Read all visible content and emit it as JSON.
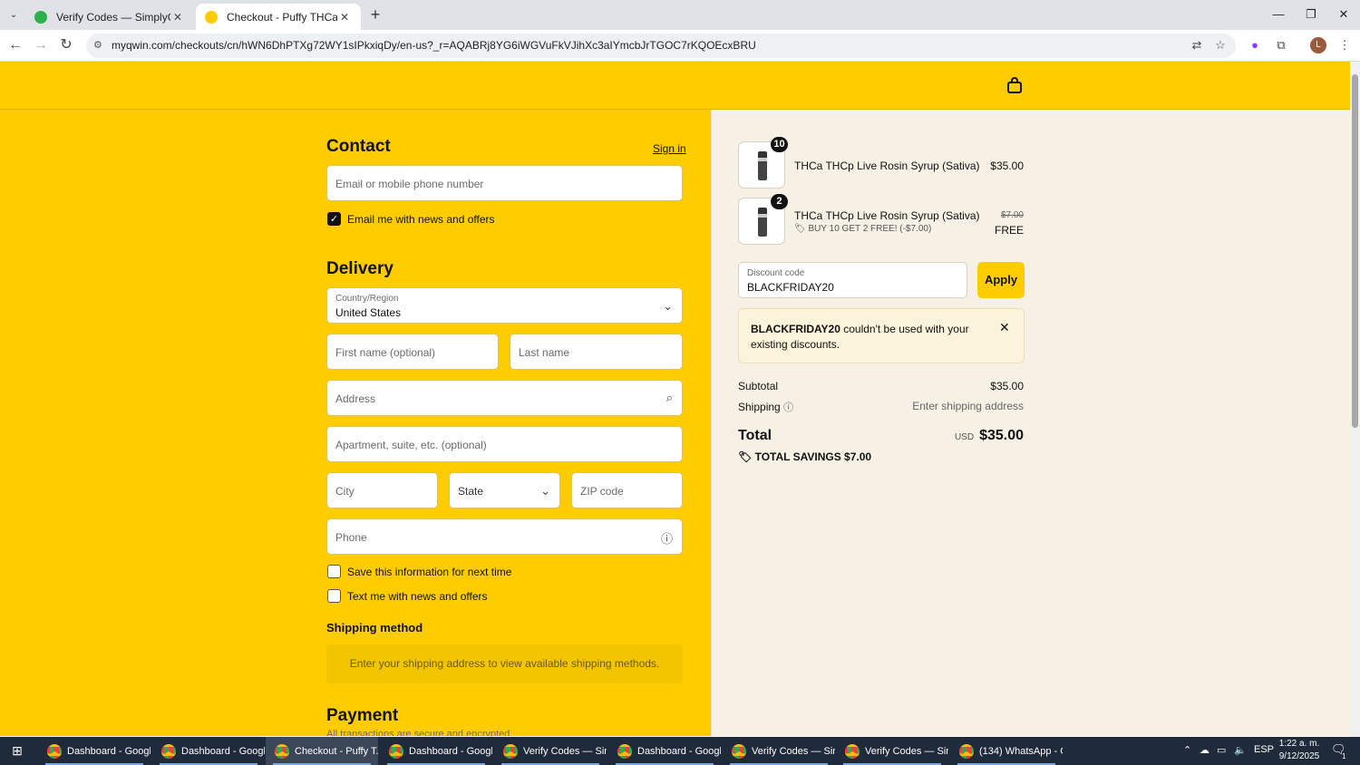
{
  "browser": {
    "tabs": [
      {
        "title": "Verify Codes — SimplyCodes",
        "active": false
      },
      {
        "title": "Checkout - Puffy THCa",
        "active": true
      }
    ],
    "url": "myqwin.com/checkouts/cn/hWN6DhPTXg72WY1sIPkxiqDy/en-us?_r=AQABRj8YG6iWGVuFkVJihXc3aIYmcbJrTGOC7rKQOEcxBRU"
  },
  "contact": {
    "heading": "Contact",
    "sign_in": "Sign in",
    "email_placeholder": "Email or mobile phone number",
    "email_news_label": "Email me with news and offers"
  },
  "delivery": {
    "heading": "Delivery",
    "country_label": "Country/Region",
    "country_value": "United States",
    "first_name_placeholder": "First name (optional)",
    "last_name_placeholder": "Last name",
    "address_placeholder": "Address",
    "apartment_placeholder": "Apartment, suite, etc. (optional)",
    "city_placeholder": "City",
    "state_placeholder": "State",
    "zip_placeholder": "ZIP code",
    "phone_placeholder": "Phone",
    "save_info_label": "Save this information for next time",
    "text_news_label": "Text me with news and offers"
  },
  "shipping_method": {
    "heading": "Shipping method",
    "message": "Enter your shipping address to view available shipping methods."
  },
  "payment": {
    "heading": "Payment",
    "subtext": "All transactions are secure and encrypted."
  },
  "summary": {
    "items": [
      {
        "qty": "10",
        "name": "THCa THCp Live Rosin Syrup (Sativa)",
        "price": "$35.00"
      },
      {
        "qty": "2",
        "name": "THCa THCp Live Rosin Syrup (Sativa)",
        "discount_tag": "BUY 10 GET 2 FREE! (-$7.00)",
        "original_price": "$7.00",
        "price": "FREE"
      }
    ],
    "discount_label": "Discount code",
    "discount_value": "BLACKFRIDAY20",
    "apply_label": "Apply",
    "error_code": "BLACKFRIDAY20",
    "error_text": " couldn't be used with your existing discounts.",
    "subtotal_label": "Subtotal",
    "subtotal_value": "$35.00",
    "shipping_label": "Shipping",
    "shipping_value": "Enter shipping address",
    "total_label": "Total",
    "total_currency": "USD",
    "total_value": "$35.00",
    "savings_label": "TOTAL SAVINGS",
    "savings_value": "$7.00"
  },
  "taskbar": {
    "items": [
      {
        "label": "Dashboard - Googl...",
        "active": false
      },
      {
        "label": "Dashboard - Googl...",
        "active": false
      },
      {
        "label": "Checkout - Puffy T...",
        "active": true
      },
      {
        "label": "Dashboard - Googl...",
        "active": false
      },
      {
        "label": "Verify Codes — Sim...",
        "active": false
      },
      {
        "label": "Dashboard - Googl...",
        "active": false
      },
      {
        "label": "Verify Codes — Sim...",
        "active": false
      },
      {
        "label": "Verify Codes — Sim...",
        "active": false
      },
      {
        "label": "(134) WhatsApp - G...",
        "active": false
      }
    ],
    "language": "ESP",
    "time": "1:22 a. m.",
    "date": "9/12/2025",
    "notification_count": "1"
  },
  "colors": {
    "brand_yellow": "#ffcc00",
    "summary_bg": "#f6f1e4"
  }
}
